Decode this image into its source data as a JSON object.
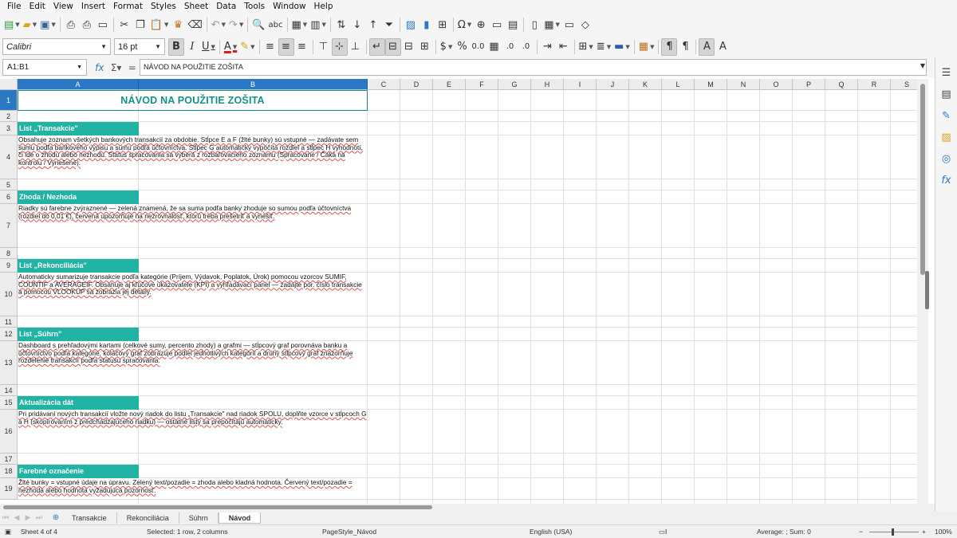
{
  "menubar": {
    "items": [
      "File",
      "Edit",
      "View",
      "Insert",
      "Format",
      "Styles",
      "Sheet",
      "Data",
      "Tools",
      "Window",
      "Help"
    ]
  },
  "toolbar2": {
    "font_name": "Calibri",
    "font_size": "16 pt"
  },
  "formula_bar": {
    "cell_ref": "A1:B1",
    "content": "NÁVOD NA POUŽITIE ZOŠITA"
  },
  "columns": [
    "A",
    "B",
    "C",
    "D",
    "E",
    "F",
    "G",
    "H",
    "I",
    "J",
    "K",
    "L",
    "M",
    "N",
    "O",
    "P",
    "Q",
    "R",
    "S"
  ],
  "rows": [
    "1",
    "2",
    "3",
    "4",
    "5",
    "6",
    "7",
    "8",
    "9",
    "10",
    "11",
    "12",
    "13",
    "14",
    "15",
    "16",
    "17",
    "18",
    "19"
  ],
  "cells": {
    "title": "NÁVOD NA POUŽITIE ZOŠITA",
    "sections": [
      {
        "heading": "List „Transakcie\"",
        "text": "Obsahuje zoznam všetkých bankových transakcií za obdobie. Stĺpce E a F (žlté bunky) sú vstupné — zadávate sem sumu podľa bankového výpisu a sumu podľa účtovníctva. Stĺpec G automaticky vypočíta rozdiel a stĺpec H vyhodnotí, či ide o zhodu alebo nezhodu. Status spracovania sa vyberá z rozbaľovacieho zoznamu (Spracované / Čaká na kontrolu / Vyriešené)."
      },
      {
        "heading": "Zhoda / Nezhoda",
        "text": "Riadky sú farebne zvýraznené — zelená znamená, že sa suma podľa banky zhoduje so sumou podľa účtovníctva (rozdiel do 0,01 €), červená upozorňuje na nezrovnalosť, ktorú treba prešetriť a vyriešiť."
      },
      {
        "heading": "List „Rekonciliácia\"",
        "text": "Automaticky sumarizuje transakcie podľa kategórie (Príjem, Výdavok, Poplatok, Úrok) pomocou vzorcov SUMIF, COUNTIF a AVERAGEIF. Obsahuje aj kľúčové ukazovatele (KPI) a vyhľadávací panel — zadajte por. číslo transakcie a pomocou VLOOKUP sa zobrazia jej detaily."
      },
      {
        "heading": "List „Súhrn\"",
        "text": "Dashboard s prehľadovými kartami (celkové sumy, percento zhody) a grafmi — stĺpcový graf porovnáva banku a účtovníctvo podľa kategórie, koláčový graf zobrazuje podiel jednotlivých kategórií a druhý stĺpcový graf znázorňuje rozdelenie transakcií podľa statusu spracovania."
      },
      {
        "heading": "Aktualizácia dát",
        "text": "Pri pridávaní nových transakcií vložte nový riadok do listu „Transakcie\" nad riadok SPOLU, doplňte vzorce v stĺpcoch G a H (skopírovaním z predchádzajúceho riadku) — ostatné listy sa prepočítajú automaticky."
      },
      {
        "heading": "Farebné označenie",
        "text": "Žlté bunky = vstupné údaje na úpravu. Zelený text/pozadie = zhoda alebo kladná hodnota. Červený text/pozadie = nezhoda alebo hodnota vyžadujúca pozornosť."
      }
    ]
  },
  "sheet_tabs": [
    "Transakcie",
    "Rekonciliácia",
    "Súhrn",
    "Návod"
  ],
  "active_tab": "Návod",
  "statusbar": {
    "sheet": "Sheet 4 of 4",
    "selection": "Selected: 1 row, 2 columns",
    "page_style": "PageStyle_Návod",
    "language": "English (USA)",
    "sum": "Average: ; Sum: 0",
    "zoom": "100%"
  },
  "colors": {
    "accent": "#21b3a4",
    "title": "#178f88",
    "selection": "#2b78c4"
  }
}
